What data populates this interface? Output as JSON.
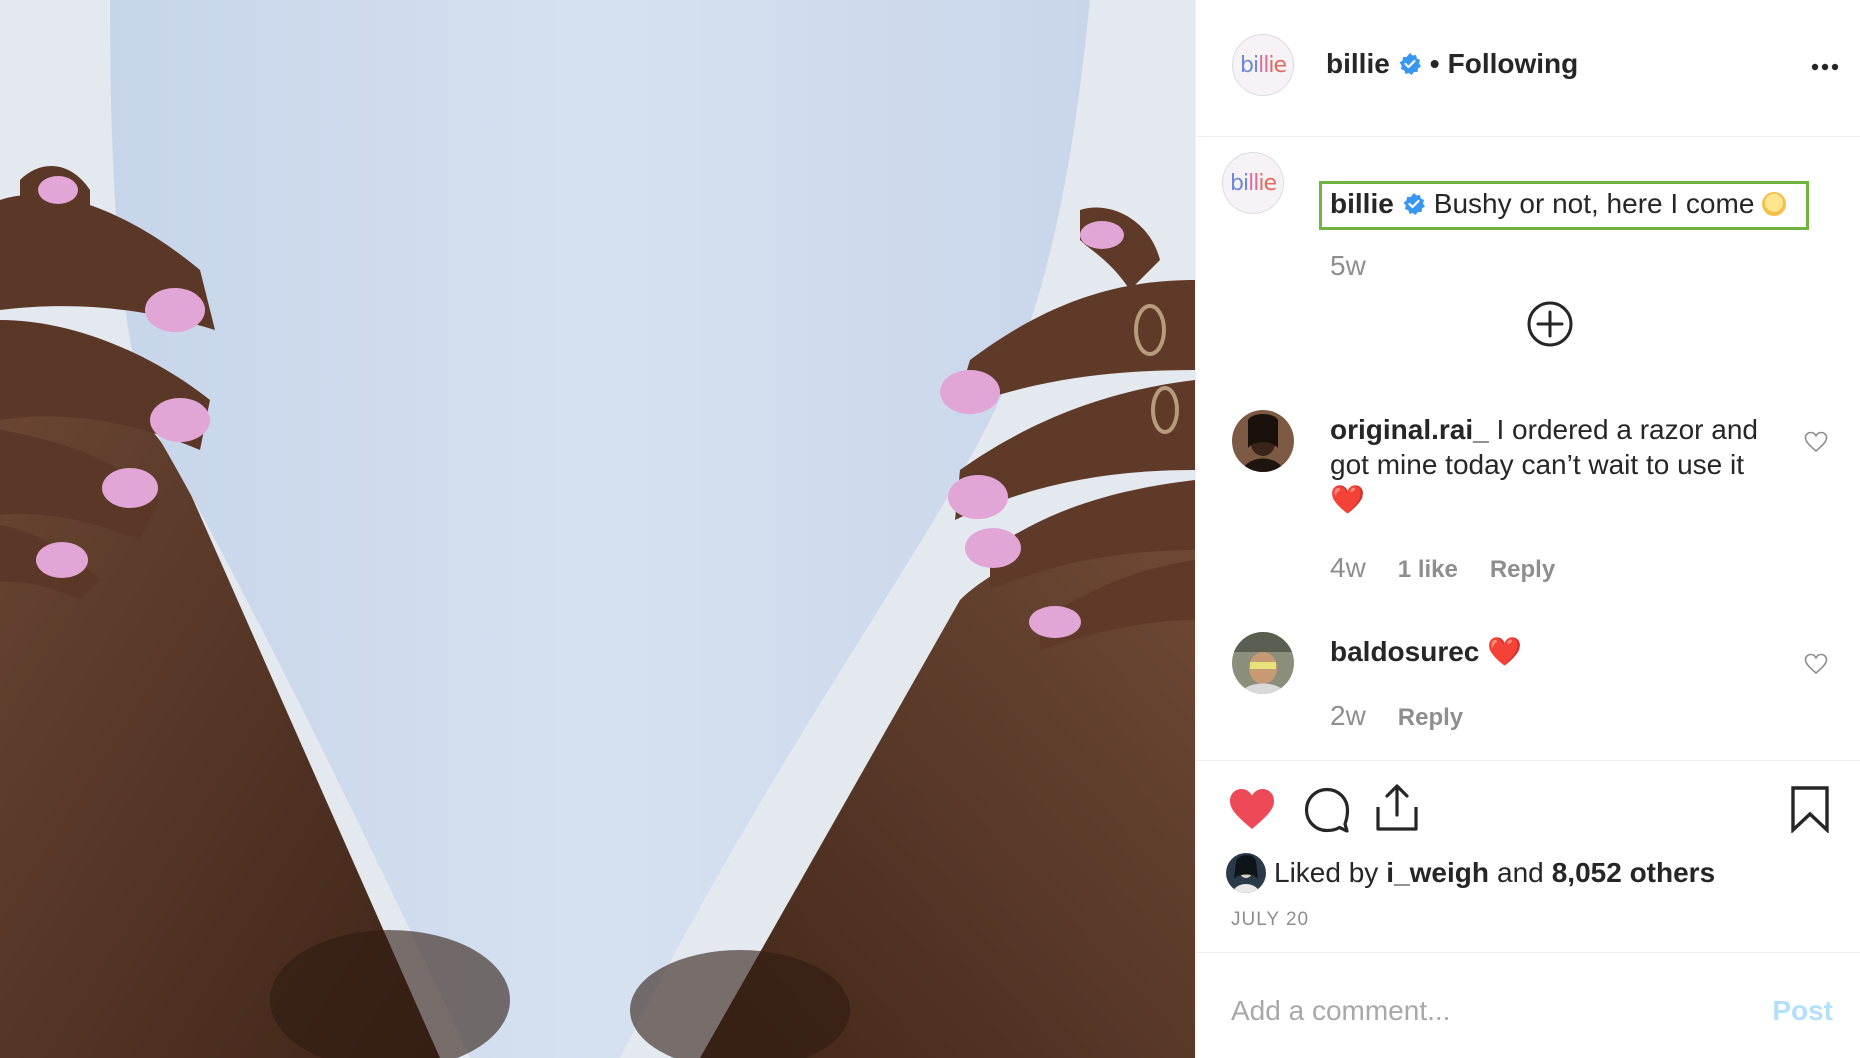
{
  "post": {
    "username": "billie",
    "follow_status": "Following",
    "separator": "•",
    "more_icon": "more-horizontal-icon",
    "logo_text": {
      "a": "bi",
      "b": "ll",
      "c": "ie"
    },
    "caption": {
      "username": "billie",
      "text": "Bushy or not, here I come",
      "age": "5w"
    }
  },
  "comments": [
    {
      "username": "original.rai_",
      "text": "I ordered a razor and got mine today can’t wait to use it",
      "emoji": "❤️",
      "age": "4w",
      "likes": "1 like",
      "reply": "Reply"
    },
    {
      "username": "baldosurec",
      "text": "",
      "emoji": "❤️",
      "age": "2w",
      "reply": "Reply"
    }
  ],
  "likes": {
    "prefix": "Liked by",
    "user": "i_weigh",
    "and": "and",
    "count": "8,052 others"
  },
  "date": "JULY 20",
  "add_comment": {
    "placeholder": "Add a comment...",
    "post_label": "Post"
  },
  "colors": {
    "verified": "#3897f0",
    "like_red": "#ed4956",
    "highlight": "#6fb43f",
    "post_disabled": "#b2dffc"
  }
}
